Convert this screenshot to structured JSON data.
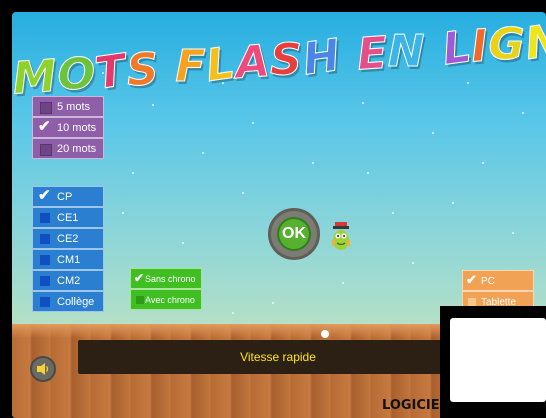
{
  "title": "MOTS FLASH EN LIGNE !",
  "title_colors": [
    "#8fd32a",
    "#6cc43a",
    "#e23a6c",
    "#f07a2a",
    "#f6a21e",
    "#f4c11c",
    "#ee4b7c",
    "#e83e3e",
    "#4b86e6",
    "#e34f8a",
    "#3cb4e8",
    "#a05ad8",
    "#f06a2a",
    "#e9d21a",
    "#f0e41a",
    "#f0e41a"
  ],
  "word_count": {
    "items": [
      {
        "label": "5 mots",
        "checked": false
      },
      {
        "label": "10 mots",
        "checked": true
      },
      {
        "label": "20 mots",
        "checked": false
      }
    ]
  },
  "levels": {
    "items": [
      {
        "label": "CP",
        "checked": true
      },
      {
        "label": "CE1",
        "checked": false
      },
      {
        "label": "CE2",
        "checked": false
      },
      {
        "label": "CM1",
        "checked": false
      },
      {
        "label": "CM2",
        "checked": false
      },
      {
        "label": "Collège",
        "checked": false
      }
    ]
  },
  "timer": {
    "items": [
      {
        "label": "Sans chrono",
        "checked": true
      },
      {
        "label": "Avec chrono",
        "checked": false
      }
    ]
  },
  "device": {
    "items": [
      {
        "label": "PC",
        "checked": true
      },
      {
        "label": "Tablette",
        "checked": false
      }
    ]
  },
  "ok_button": {
    "label": "OK"
  },
  "speed": {
    "label": "Vitesse rapide"
  },
  "brand": {
    "text": "LOGICIE"
  },
  "sound_icon": "speaker-icon",
  "colors": {
    "words_panel": "#8e5fa8",
    "levels_panel": "#2a7fd0",
    "timer_panel": "#3fbf22",
    "device_panel": "#f2a254",
    "speed_text": "#ffe51a"
  }
}
